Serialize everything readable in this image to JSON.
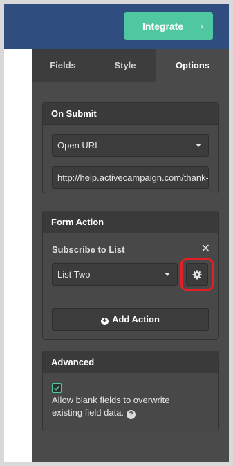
{
  "header": {
    "integrate_label": "Integrate",
    "integrate_chevron": "›"
  },
  "tabs": [
    {
      "label": "Fields",
      "active": false
    },
    {
      "label": "Style",
      "active": false
    },
    {
      "label": "Options",
      "active": true
    }
  ],
  "on_submit": {
    "title": "On Submit",
    "action_select": "Open URL",
    "url_value": "http://help.activecampaign.com/thank-you"
  },
  "form_action": {
    "title": "Form Action",
    "action_label": "Subscribe to List",
    "remove_symbol": "✕",
    "list_select": "List Two",
    "add_action_label": "Add Action"
  },
  "advanced": {
    "title": "Advanced",
    "overwrite_checked": true,
    "overwrite_label_line1": "Allow blank fields to overwrite",
    "overwrite_label_line2": "existing field data.",
    "help_symbol": "?"
  },
  "colors": {
    "brand_blue": "#2f4d7e",
    "accent_green": "#4fc7a1",
    "highlight_red": "#e31f26"
  }
}
